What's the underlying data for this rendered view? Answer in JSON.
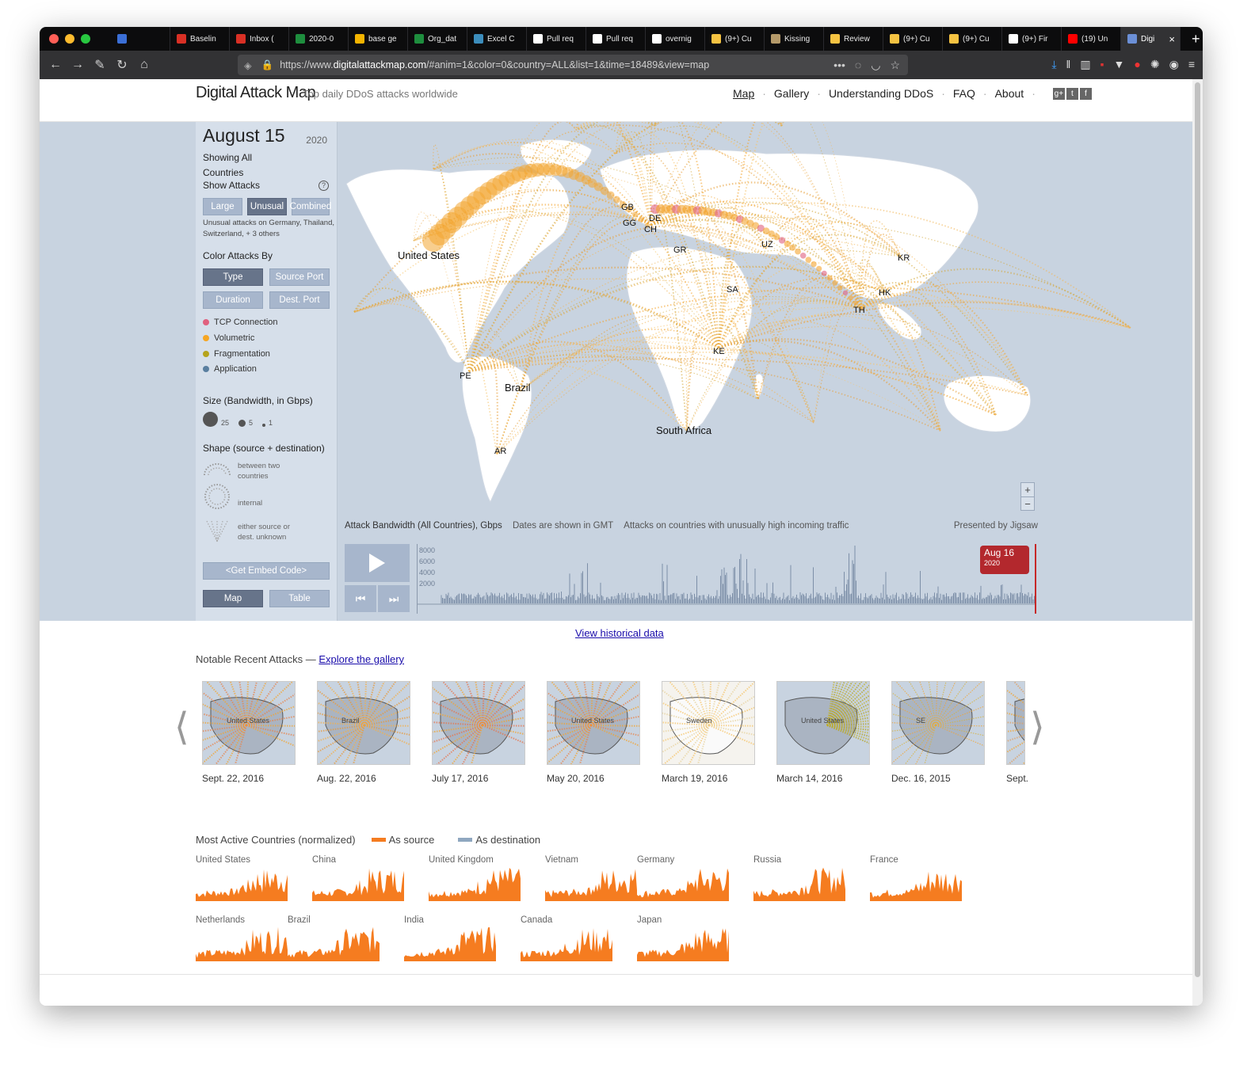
{
  "browser": {
    "tabs": [
      {
        "label": "",
        "color": "#3b6fd6"
      },
      {
        "label": "Baselin",
        "color": "#d93025"
      },
      {
        "label": "Inbox (",
        "color": "#d93025"
      },
      {
        "label": "2020-0",
        "color": "#1e8e3e"
      },
      {
        "label": "base ge",
        "color": "#f4b400"
      },
      {
        "label": "Org_dat",
        "color": "#1e8e3e"
      },
      {
        "label": "Excel C",
        "color": "#3c8dbc"
      },
      {
        "label": "Pull req",
        "color": "#ffffff"
      },
      {
        "label": "Pull req",
        "color": "#ffffff"
      },
      {
        "label": "overnig",
        "color": "#ffffff"
      },
      {
        "label": "(9+) Cu",
        "color": "#f6c342"
      },
      {
        "label": "Kissing",
        "color": "#b59a6a"
      },
      {
        "label": "Review",
        "color": "#f6c342"
      },
      {
        "label": "(9+) Cu",
        "color": "#f6c342"
      },
      {
        "label": "(9+) Cu",
        "color": "#f6c342"
      },
      {
        "label": "(9+) Fir",
        "color": "#ffffff"
      },
      {
        "label": "(19) Un",
        "color": "#ff0000"
      },
      {
        "label": "Digi",
        "color": "#6b8fd6"
      }
    ],
    "url_prefix": "https://www.",
    "url_host": "digitalattackmap.com",
    "url_rest": "/#anim=1&color=0&country=ALL&list=1&time=18489&view=map"
  },
  "header": {
    "logo": "Digital Attack Map",
    "tagline": "Top daily DDoS attacks worldwide",
    "nav": [
      "Map",
      "Gallery",
      "Understanding DDoS",
      "FAQ",
      "About"
    ]
  },
  "panel": {
    "date": "August 15",
    "year": "2020",
    "showing": "Showing All",
    "countries": "Countries",
    "show_attacks": "Show Attacks",
    "attack_buttons": [
      "Large",
      "Unusual",
      "Combined"
    ],
    "unusual_note_1": "Unusual attacks on Germany, Thailand,",
    "unusual_note_2": "Switzerland, + 3 others",
    "color_by": "Color Attacks By",
    "color_buttons": [
      "Type",
      "Source Port",
      "Duration",
      "Dest. Port"
    ],
    "legend": [
      {
        "label": "TCP Connection",
        "color": "#e0607e"
      },
      {
        "label": "Volumetric",
        "color": "#f6a623"
      },
      {
        "label": "Fragmentation",
        "color": "#b5a31c"
      },
      {
        "label": "Application",
        "color": "#5a7fa0"
      }
    ],
    "size_title": "Size (Bandwidth, in Gbps)",
    "size_labels": [
      "25",
      "5",
      "1"
    ],
    "shape_title": "Shape (source + destination)",
    "shape_between_1": "between two",
    "shape_between_2": "countries",
    "shape_internal": "internal",
    "shape_unknown_1": "either source or",
    "shape_unknown_2": "dest. unknown",
    "embed": "<Get Embed Code>",
    "view_buttons": [
      "Map",
      "Table"
    ]
  },
  "map": {
    "labels": [
      "United States",
      "GB",
      "GG",
      "DE",
      "CH",
      "GR",
      "UZ",
      "KR",
      "SA",
      "HK",
      "TH",
      "KE",
      "PE",
      "Brazil",
      "South Africa",
      "AR"
    ]
  },
  "timeline": {
    "title": "Attack Bandwidth (All Countries), Gbps",
    "gmt": "Dates are shown in GMT",
    "unusual": "Attacks on countries with unusually high incoming traffic",
    "presented": "Presented by Jigsaw",
    "y_ticks": [
      "8000",
      "6000",
      "4000",
      "2000"
    ],
    "bubble_date": "Aug 16",
    "bubble_year": "2020"
  },
  "historical_link": "View historical data",
  "notable": {
    "title": "Notable Recent Attacks —",
    "link": "Explore the gallery",
    "items": [
      {
        "date": "Sept. 22, 2016",
        "label": "United States"
      },
      {
        "date": "Aug. 22, 2016",
        "label": "Brazil"
      },
      {
        "date": "July 17, 2016",
        "label": ""
      },
      {
        "date": "May 20, 2016",
        "label": "United States"
      },
      {
        "date": "March 19, 2016",
        "label": "Sweden"
      },
      {
        "date": "March 14, 2016",
        "label": "United States"
      },
      {
        "date": "Dec. 16, 2015",
        "label": "SE"
      },
      {
        "date": "Sept.",
        "label": ""
      }
    ]
  },
  "active": {
    "title": "Most Active Countries (normalized)",
    "as_source": "As source",
    "as_destination": "As destination",
    "source_color": "#f57c20",
    "destination_color": "#8fa7c0",
    "countries": [
      "United States",
      "China",
      "United Kingdom",
      "Vietnam",
      "Germany",
      "Russia",
      "France",
      "Netherlands",
      "Brazil",
      "India",
      "Canada",
      "Japan"
    ]
  }
}
